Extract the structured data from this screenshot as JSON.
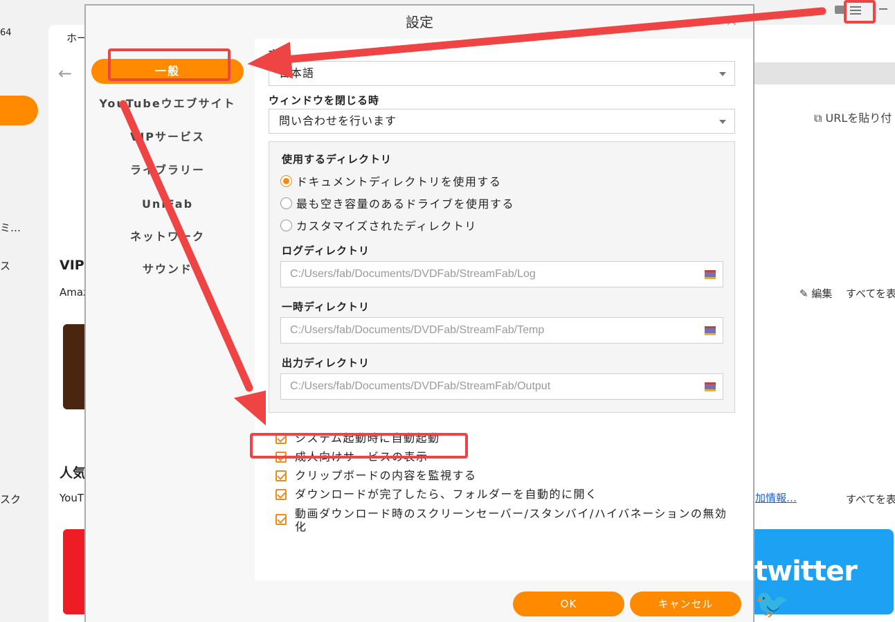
{
  "background": {
    "left_texts": [
      "64",
      "ミ…",
      "ス",
      "スク"
    ],
    "tab_label": "ホー",
    "section_vip": "VIP",
    "sub_vip": "Amaz",
    "section_popular": "人気",
    "sub_popular": "YouT",
    "url_button": "URLを貼り付",
    "edit_label": "編集",
    "show_all_1": "すべてを表",
    "info_link": "加情報…",
    "show_all_2": "すべてを表",
    "twitter_logo": "twitter"
  },
  "modal": {
    "title": "設定",
    "close": "×",
    "sidebar": [
      {
        "label": "一般",
        "active": true
      },
      {
        "label": "YouTubeウエブサイト",
        "active": false
      },
      {
        "label": "VIPサービス",
        "active": false
      },
      {
        "label": "ライブラリー",
        "active": false
      },
      {
        "label": "UniFab",
        "active": false
      },
      {
        "label": "ネットワーク",
        "active": false
      },
      {
        "label": "サウンド",
        "active": false
      }
    ],
    "language": {
      "label": "言語",
      "value": "日本語"
    },
    "on_close": {
      "label": "ウィンドウを閉じる時",
      "value": "問い合わせを行います"
    },
    "directories": {
      "label": "使用するディレクトリ",
      "options": [
        {
          "label": "ドキュメントディレクトリを使用する",
          "selected": true
        },
        {
          "label": "最も空き容量のあるドライブを使用する",
          "selected": false
        },
        {
          "label": "カスタマイズされたディレクトリ",
          "selected": false
        }
      ],
      "log": {
        "label": "ログディレクトリ",
        "value": "C:/Users/fab/Documents/DVDFab/StreamFab/Log"
      },
      "temp": {
        "label": "一時ディレクトリ",
        "value": "C:/Users/fab/Documents/DVDFab/StreamFab/Temp"
      },
      "output": {
        "label": "出力ディレクトリ",
        "value": "C:/Users/fab/Documents/DVDFab/StreamFab/Output"
      }
    },
    "checkboxes": [
      {
        "label": "システム起動時に自動起動",
        "checked": true
      },
      {
        "label": "成人向けサービスの表示",
        "checked": true
      },
      {
        "label": "クリップボードの内容を監視する",
        "checked": true
      },
      {
        "label": "ダウンロードが完了したら、フォルダーを自動的に開く",
        "checked": true
      },
      {
        "label_line1": "動画ダウンロード時のスクリーンセーバー/スタンバイ/ハイバネーションの無効",
        "label_line2": "化",
        "checked": true
      }
    ],
    "buttons": {
      "ok": "OK",
      "cancel": "キャンセル"
    }
  },
  "colors": {
    "accent": "#ff8a00",
    "annotation": "#ee4444"
  }
}
